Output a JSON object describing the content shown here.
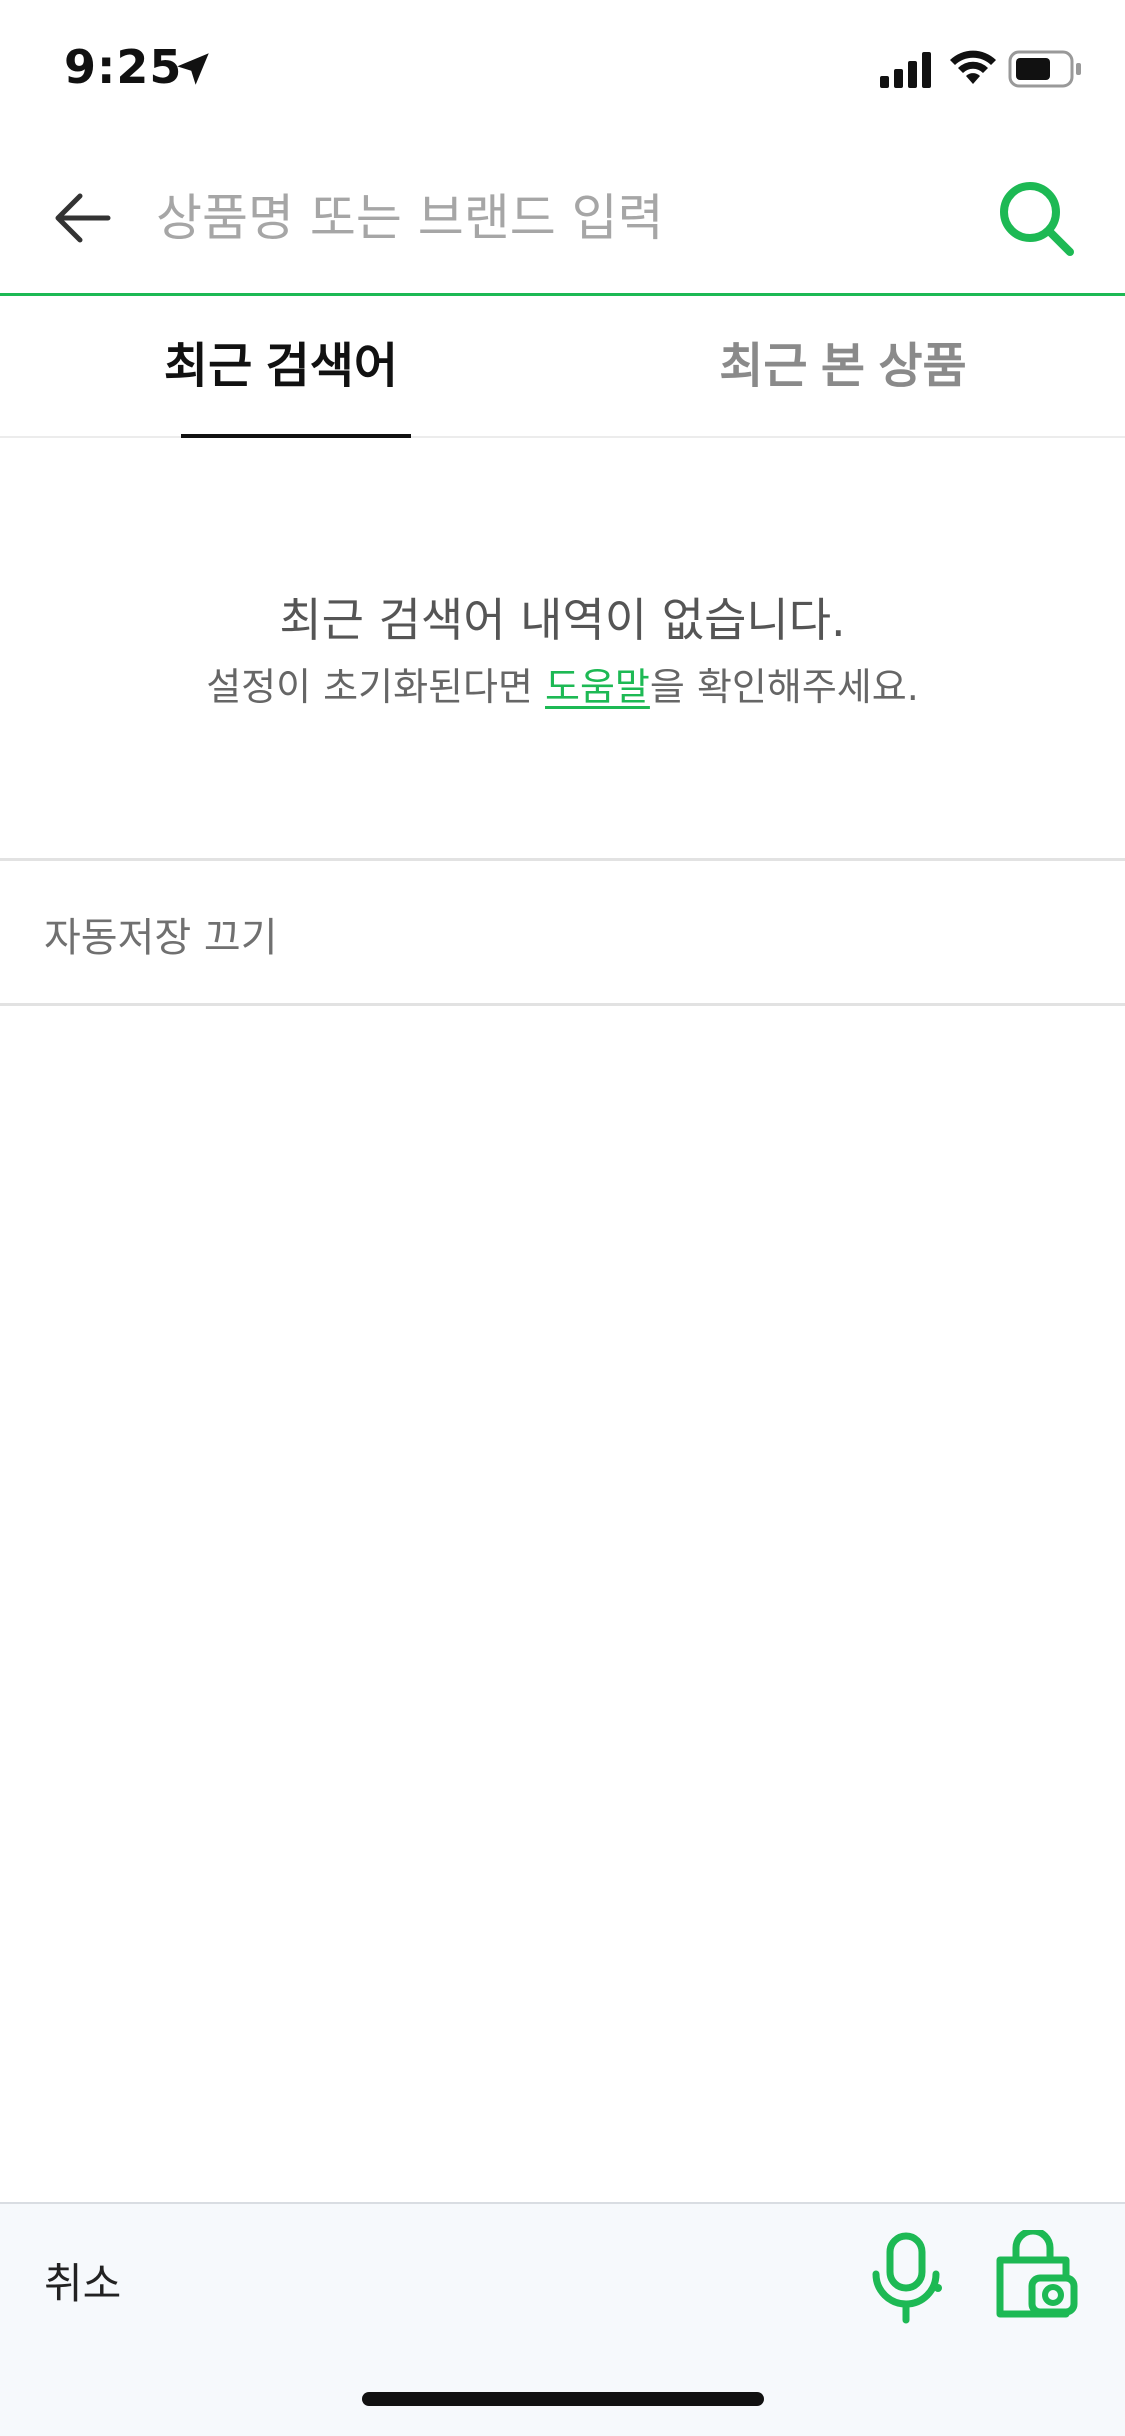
{
  "status_bar": {
    "time": "9:25",
    "icons": [
      "location-arrow-icon",
      "signal-icon",
      "wifi-icon",
      "battery-icon"
    ]
  },
  "search": {
    "placeholder": "상품명 또는 브랜드 입력",
    "value": "",
    "accent_color": "#1db954"
  },
  "tabs": {
    "items": [
      {
        "label": "최근 검색어",
        "active": true
      },
      {
        "label": "최근 본 상품",
        "active": false
      }
    ]
  },
  "empty_state": {
    "title": "최근 검색어 내역이 없습니다.",
    "desc_before": "설정이 초기화된다면 ",
    "help_link": "도움말",
    "desc_after": "을 확인해주세요."
  },
  "autosave": {
    "label": "자동저장 끄기"
  },
  "bottom_bar": {
    "cancel_label": "취소",
    "icons": [
      "microphone-icon",
      "camera-bag-icon"
    ]
  }
}
